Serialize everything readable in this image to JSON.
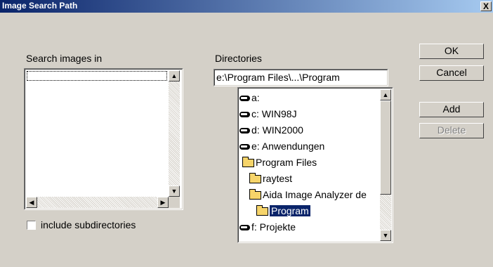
{
  "window": {
    "title": "Image Search Path",
    "close_glyph": "X"
  },
  "left": {
    "label": "Search images in",
    "include_subdirs_label": "include subdirectories",
    "include_subdirs_checked": false
  },
  "right": {
    "label": "Directories",
    "path_value": "e:\\Program Files\\...\\Program",
    "tree": [
      {
        "icon": "drive-icon",
        "label": "a:"
      },
      {
        "icon": "drive-icon",
        "label": "c: WIN98J"
      },
      {
        "icon": "drive-icon",
        "label": "d: WIN2000"
      },
      {
        "icon": "drive-icon",
        "label": "e: Anwendungen"
      },
      {
        "icon": "open-folder-icon",
        "label": "Program Files"
      },
      {
        "icon": "open-folder-icon",
        "label": "raytest"
      },
      {
        "icon": "open-folder-icon",
        "label": "Aida Image Analyzer de"
      },
      {
        "icon": "open-folder-icon",
        "label": "Program",
        "selected": true
      },
      {
        "icon": "drive-icon",
        "label": "f: Projekte"
      }
    ]
  },
  "buttons": {
    "ok": "OK",
    "cancel": "Cancel",
    "add": "Add",
    "delete": "Delete"
  },
  "colors": {
    "face": "#d4d0c8",
    "title_start": "#0a246a",
    "title_end": "#a6caf0",
    "selection": "#0a246a"
  }
}
